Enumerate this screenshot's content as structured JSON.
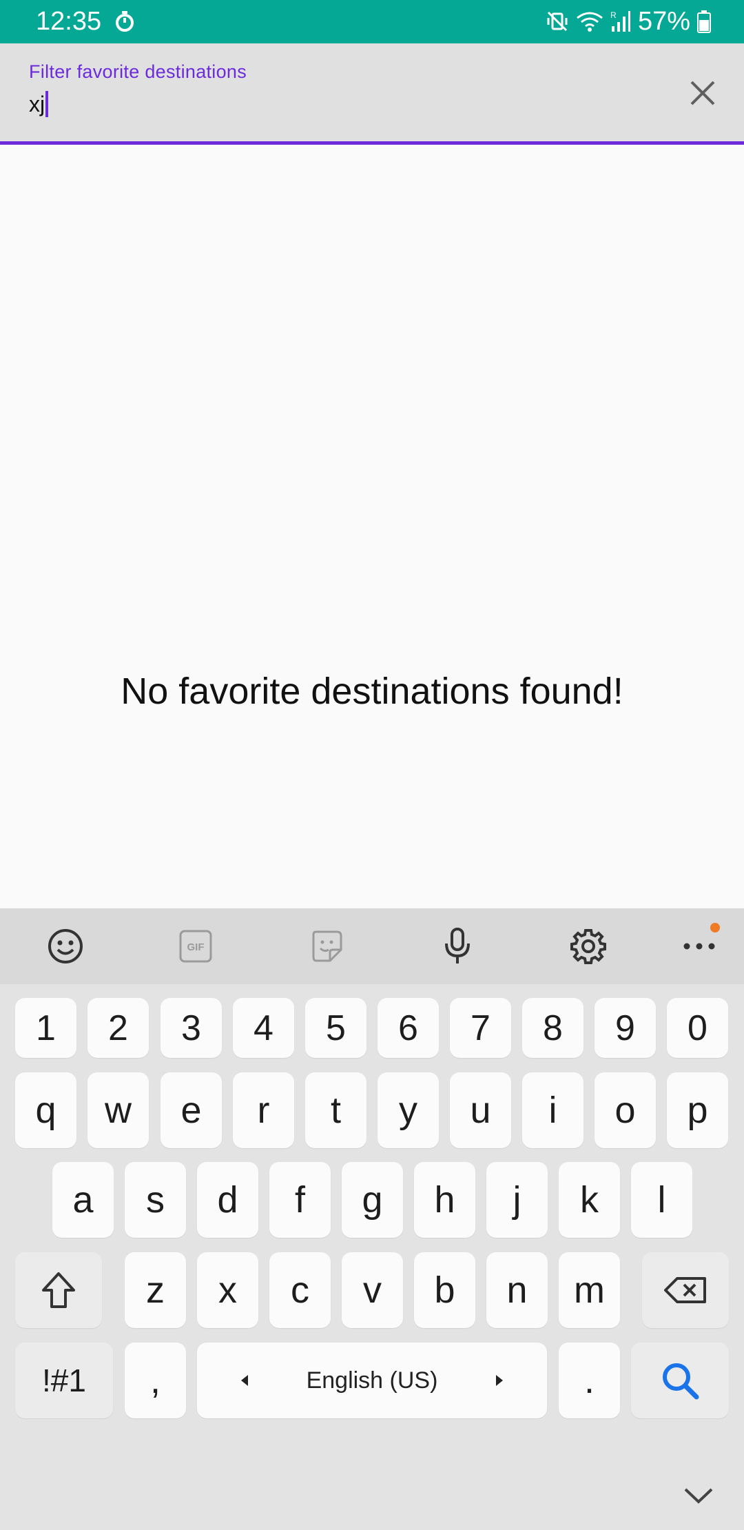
{
  "status_bar": {
    "time": "12:35",
    "battery": "57%",
    "icons": [
      "timer-icon",
      "vibrate-mute-icon",
      "wifi-icon",
      "signal-icon",
      "battery-icon"
    ]
  },
  "search": {
    "label": "Filter favorite destinations",
    "value": "xj",
    "clear_icon": "close-icon",
    "accent_color": "#6b2bdb"
  },
  "content": {
    "empty_message": "No favorite destinations found!"
  },
  "keyboard": {
    "toolbar_icons": [
      "emoji-icon",
      "gif-icon",
      "sticker-icon",
      "microphone-icon",
      "settings-icon",
      "more-icon"
    ],
    "rows": {
      "numbers": [
        "1",
        "2",
        "3",
        "4",
        "5",
        "6",
        "7",
        "8",
        "9",
        "0"
      ],
      "row1": [
        "q",
        "w",
        "e",
        "r",
        "t",
        "y",
        "u",
        "i",
        "o",
        "p"
      ],
      "row2": [
        "a",
        "s",
        "d",
        "f",
        "g",
        "h",
        "j",
        "k",
        "l"
      ],
      "row3": [
        "z",
        "x",
        "c",
        "v",
        "b",
        "n",
        "m"
      ]
    },
    "symbols_key": "!#1",
    "comma_key": ",",
    "space_label": "English (US)",
    "period_key": ".",
    "action_icon": "search-icon",
    "accent_color": "#1a73e8"
  },
  "colors": {
    "status_bar": "#04a895",
    "header_bg": "#e0e0e0"
  }
}
